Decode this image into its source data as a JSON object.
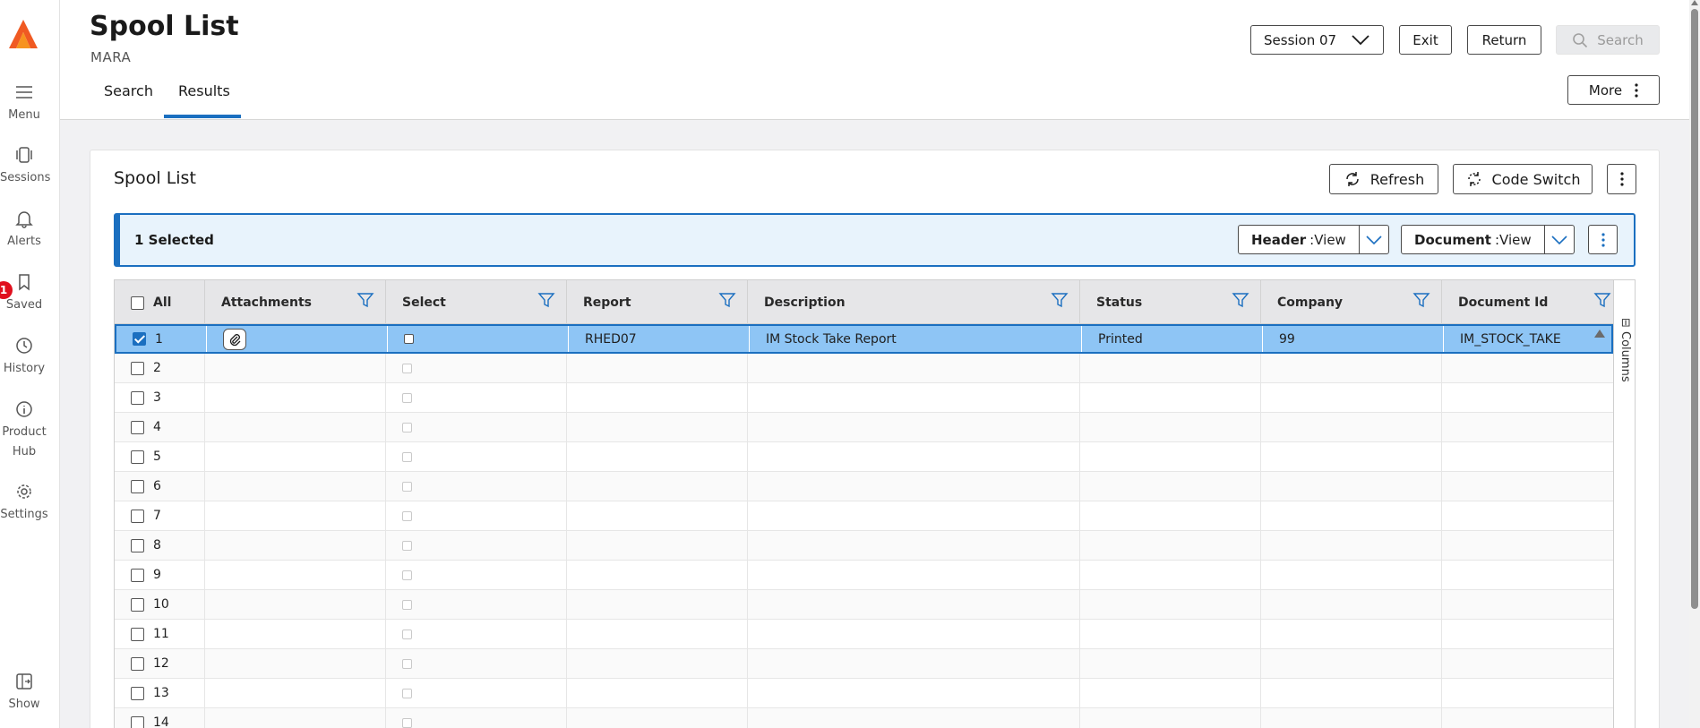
{
  "header": {
    "title": "Spool List",
    "subtitle": "MARA",
    "tabs": [
      {
        "label": "Search"
      },
      {
        "label": "Results"
      }
    ],
    "session_label": "Session 07",
    "exit_label": "Exit",
    "return_label": "Return",
    "search_label": "Search",
    "more_label": "More"
  },
  "rail": {
    "items": [
      {
        "label": "Menu",
        "icon": "menu-icon"
      },
      {
        "label": "Sessions",
        "icon": "sessions-icon"
      },
      {
        "label": "Alerts",
        "icon": "bell-icon"
      },
      {
        "label": "Saved",
        "icon": "bookmark-icon"
      },
      {
        "label": "History",
        "icon": "clock-icon"
      },
      {
        "label": "Product",
        "label2": "Hub",
        "icon": "info-icon"
      },
      {
        "label": "Settings",
        "icon": "gear-icon"
      },
      {
        "label": "Show",
        "icon": "show-panel-icon"
      }
    ],
    "saved_badge": "1"
  },
  "card": {
    "title": "Spool List",
    "refresh_label": "Refresh",
    "code_switch_label": "Code Switch"
  },
  "selection": {
    "text": "1 Selected",
    "header_view": {
      "key": "Header",
      "value": " View"
    },
    "document_view": {
      "key": "Document",
      "value": " View"
    }
  },
  "grid": {
    "all_label": "All",
    "columns": [
      "Attachments",
      "Select",
      "Report",
      "Description",
      "Status",
      "Company",
      "Document Id"
    ],
    "side_panel_label": "Columns",
    "rows": [
      {
        "n": "1",
        "report": "RHED07",
        "description": "IM Stock Take Report",
        "status": "Printed",
        "company": "99",
        "document_id": "IM_STOCK_TAKE",
        "selected": true
      },
      {
        "n": "2"
      },
      {
        "n": "3"
      },
      {
        "n": "4"
      },
      {
        "n": "5"
      },
      {
        "n": "6"
      },
      {
        "n": "7"
      },
      {
        "n": "8"
      },
      {
        "n": "9"
      },
      {
        "n": "10"
      },
      {
        "n": "11"
      },
      {
        "n": "12"
      },
      {
        "n": "13"
      },
      {
        "n": "14"
      }
    ]
  },
  "colors": {
    "accent": "#1b6fc0",
    "selected_row": "#8ec5f5",
    "logo_top": "#f05a22",
    "logo_bottom": "#f7931e"
  }
}
